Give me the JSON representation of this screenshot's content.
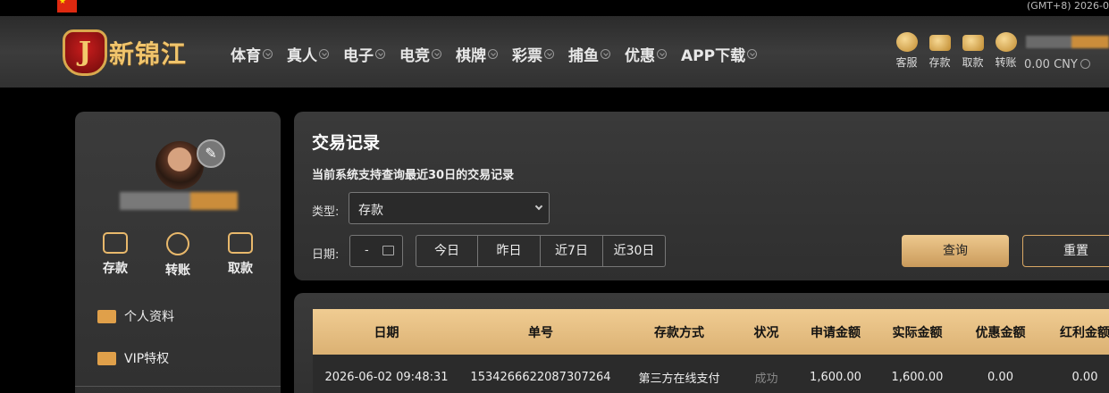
{
  "topbar": {
    "clock": "(GMT+8) 2026-0"
  },
  "header": {
    "logo_text": "新锦江",
    "logo_letter": "J",
    "nav": [
      "体育",
      "真人",
      "电子",
      "电竞",
      "棋牌",
      "彩票",
      "捕鱼",
      "优惠",
      "APP下载"
    ],
    "actions": [
      "客服",
      "存款",
      "取款",
      "转账"
    ],
    "balance": "0.00 CNY"
  },
  "sidebar": {
    "quick": [
      "存款",
      "转账",
      "取款"
    ],
    "menu": [
      "个人资料",
      "VIP特权"
    ]
  },
  "panel": {
    "title": "交易记录",
    "subtitle": "当前系统支持查询最近30日的交易记录",
    "type_label": "类型:",
    "type_value": "存款",
    "date_label": "日期:",
    "date_value": "-",
    "quick_dates": [
      "今日",
      "昨日",
      "近7日",
      "近30日"
    ],
    "query_label": "查询",
    "reset_label": "重置"
  },
  "table": {
    "headers": [
      "日期",
      "单号",
      "存款方式",
      "状况",
      "申请金额",
      "实际金额",
      "优惠金额",
      "红利金额"
    ],
    "rows": [
      [
        "2026-06-02 09:48:31",
        "1534266622087307264",
        "第三方在线支付",
        "成功",
        "1,600.00",
        "1,600.00",
        "0.00",
        "0.00"
      ]
    ]
  },
  "colors": {
    "gold": "#e8b86b",
    "accent_orange": "#e0a04a",
    "flag_red": "#de2910"
  }
}
